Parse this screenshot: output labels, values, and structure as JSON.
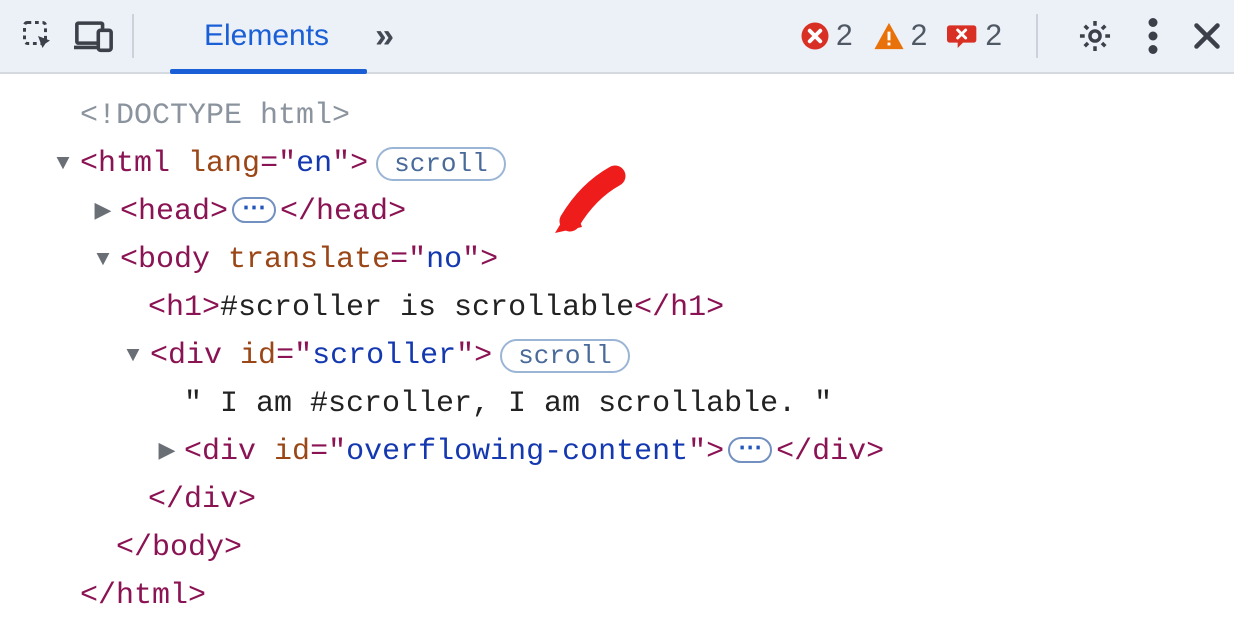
{
  "toolbar": {
    "tab_elements": "Elements",
    "more_tabs": "»",
    "errors_count": "2",
    "warnings_count": "2",
    "issues_count": "2"
  },
  "dom": {
    "doctype": "<!DOCTYPE html>",
    "html_open_pre": "<",
    "html_tag": "html",
    "html_attr_sp": " ",
    "html_attr_name": "lang",
    "html_eq": "=\"",
    "html_lang_val": "en",
    "html_close_q": "\">",
    "scroll_badge": "scroll",
    "head_open_pre": "<",
    "head_tag": "head",
    "head_gt": ">",
    "head_close": "</head>",
    "body_open_pre": "<",
    "body_tag": "body",
    "body_attr_sp": " ",
    "body_attr_name": "translate",
    "body_attr_val": "no",
    "h1_open": "<h1>",
    "h1_text": "#scroller is scrollable",
    "h1_close": "</h1>",
    "div_open_pre": "<",
    "div_tag": "div",
    "div_attr_sp": " ",
    "div_attr_name": "id",
    "div_id_val": "scroller",
    "scroll_badge2": "scroll",
    "scroller_text": "\" I am #scroller, I am scrollable. \"",
    "div2_open_pre": "<",
    "div2_tag": "div",
    "div2_attr_sp": " ",
    "div2_attr_name": "id",
    "div2_id_val": "overflowing-content",
    "div2_close": "</div>",
    "div_close": "</div>",
    "body_close": "</body>",
    "html_close": "</html>",
    "ellipsis": "⋯"
  }
}
